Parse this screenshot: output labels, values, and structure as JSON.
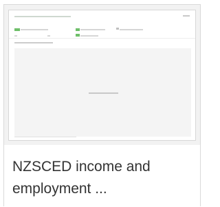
{
  "card": {
    "title": "NZSCED income and employment ..."
  }
}
